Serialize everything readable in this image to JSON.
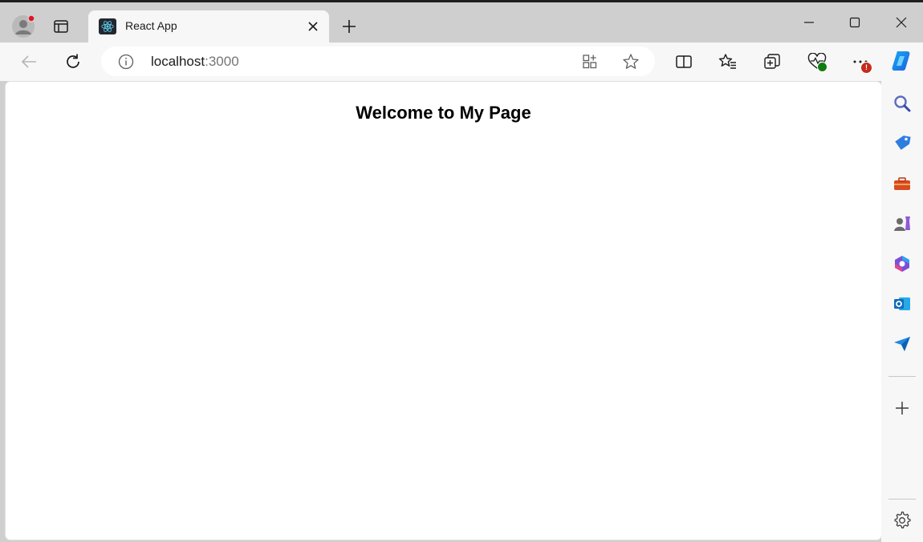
{
  "browser": {
    "tab": {
      "title": "React App",
      "favicon": "react-logo-icon"
    },
    "address_bar": {
      "host": "localhost",
      "port": ":3000"
    },
    "sidebar_icons": [
      "search-icon",
      "shopping-tag-icon",
      "tools-icon",
      "games-icon",
      "microsoft-365-icon",
      "outlook-icon",
      "drop-icon",
      "add-icon",
      "settings-icon"
    ],
    "more_badge": "!"
  },
  "page": {
    "heading": "Welcome to My Page"
  },
  "colors": {
    "tabstrip_bg": "#cfcfcf",
    "toolbar_bg": "#f7f7f7",
    "page_bg": "#ffffff",
    "badge_red": "#c42b1c",
    "badge_green": "#107c10"
  }
}
